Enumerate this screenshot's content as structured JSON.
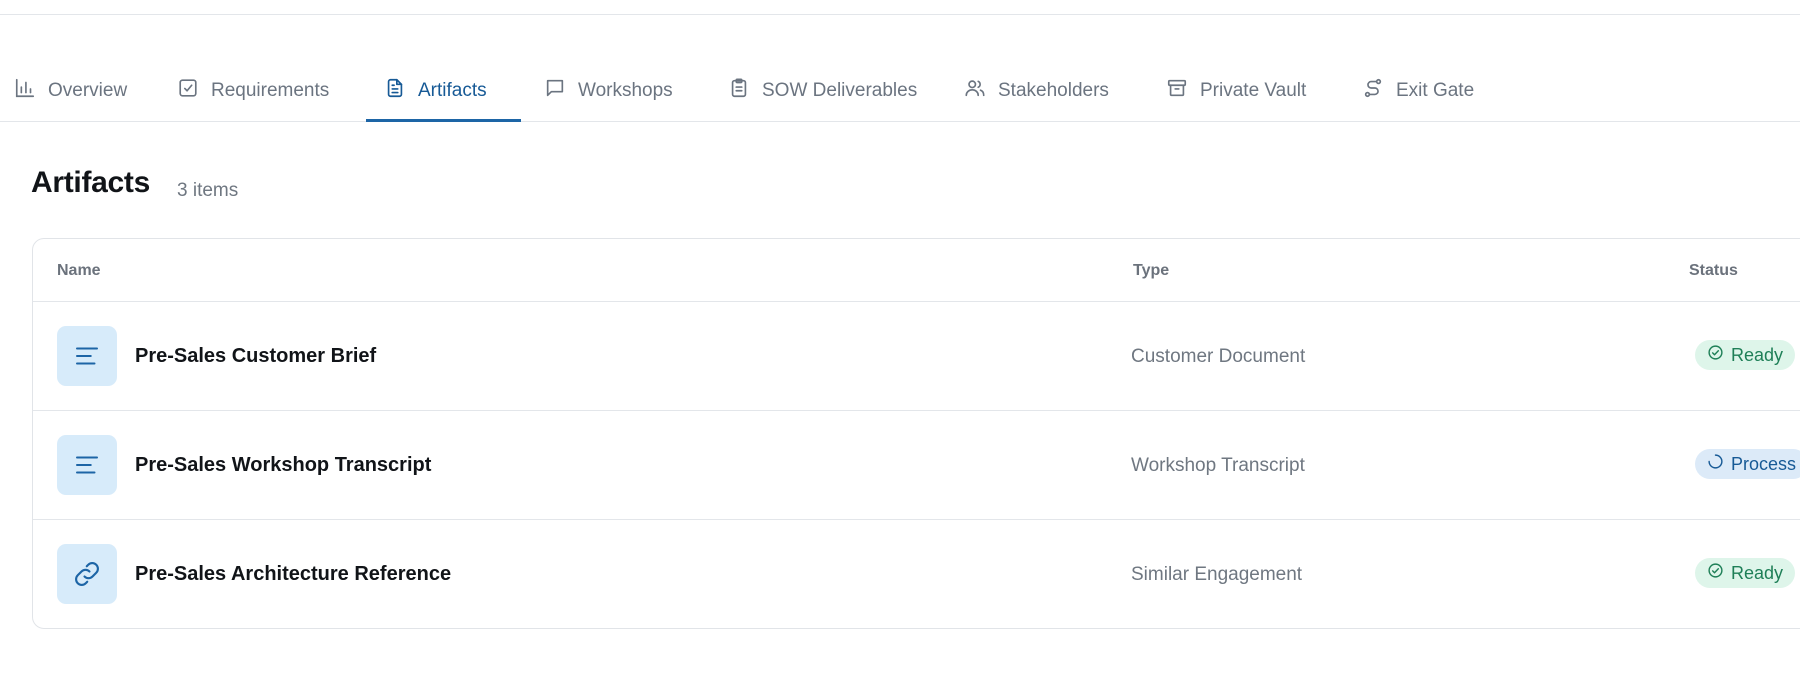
{
  "tabs": [
    {
      "label": "Overview",
      "icon": "bar-chart-icon",
      "active": false
    },
    {
      "label": "Requirements",
      "icon": "checkbox-icon",
      "active": false
    },
    {
      "label": "Artifacts",
      "icon": "document-icon",
      "active": true
    },
    {
      "label": "Workshops",
      "icon": "chat-bubble-icon",
      "active": false
    },
    {
      "label": "SOW Deliverables",
      "icon": "clipboard-icon",
      "active": false
    },
    {
      "label": "Stakeholders",
      "icon": "users-icon",
      "active": false
    },
    {
      "label": "Private Vault",
      "icon": "archive-box-icon",
      "active": false
    },
    {
      "label": "Exit Gate",
      "icon": "route-icon",
      "active": false
    }
  ],
  "section": {
    "title": "Artifacts",
    "count": "3 items"
  },
  "table": {
    "headers": {
      "name": "Name",
      "type": "Type",
      "status": "Status"
    },
    "rows": [
      {
        "name": "Pre-Sales Customer Brief",
        "type": "Customer Document",
        "status": "Ready",
        "icon": "text-lines-icon"
      },
      {
        "name": "Pre-Sales Workshop Transcript",
        "type": "Workshop Transcript",
        "status": "Process",
        "icon": "text-lines-icon"
      },
      {
        "name": "Pre-Sales Architecture Reference",
        "type": "Similar Engagement",
        "status": "Ready",
        "icon": "link-icon"
      }
    ]
  },
  "colors": {
    "accent": "#1d65a6",
    "ready_bg": "#def5ea",
    "ready_text": "#1e7f57",
    "processing_bg": "#dceaf8",
    "icon_tile_bg": "#d7ebfa"
  }
}
